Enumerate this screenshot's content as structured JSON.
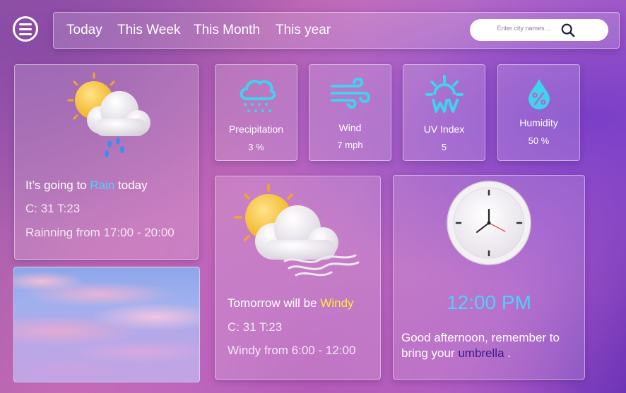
{
  "nav": {
    "tabs": [
      "Today",
      "This Week",
      "This Month",
      "This year"
    ],
    "search_placeholder": "Enter city names...."
  },
  "today": {
    "headline_pre": "It’s going to ",
    "headline_highlight": "Rain",
    "headline_post": " today",
    "temps": "C: 31 T:23",
    "detail": "Rainning from  17:00 - 20:00",
    "highlight_color": "#4fd0ff"
  },
  "stats": [
    {
      "label": "Precipitation",
      "value": "3 %",
      "icon": "rain-cloud-icon"
    },
    {
      "label": "Wind",
      "value": "7 mph",
      "icon": "wind-icon"
    },
    {
      "label": "UV Index",
      "value": "5",
      "icon": "sun-uv-icon"
    },
    {
      "label": "Humidity",
      "value": "50 %",
      "icon": "humidity-drop-icon"
    }
  ],
  "tomorrow": {
    "headline_pre": "Tomorrow will be ",
    "headline_highlight": "Windy",
    "temps": "C: 31 T:23",
    "detail": "Windy from 6:00 - 12:00",
    "highlight_color": "#ffe93a"
  },
  "clock": {
    "time": "12:00 PM",
    "greeting_pre": "Good afternoon, remember to bring your ",
    "greeting_highlight": "umbrella",
    "greeting_post": " .",
    "time_color": "#4fd0ff",
    "highlight_color": "#3a1a8a"
  },
  "colors": {
    "icon_accent": "#3fd3f0"
  }
}
